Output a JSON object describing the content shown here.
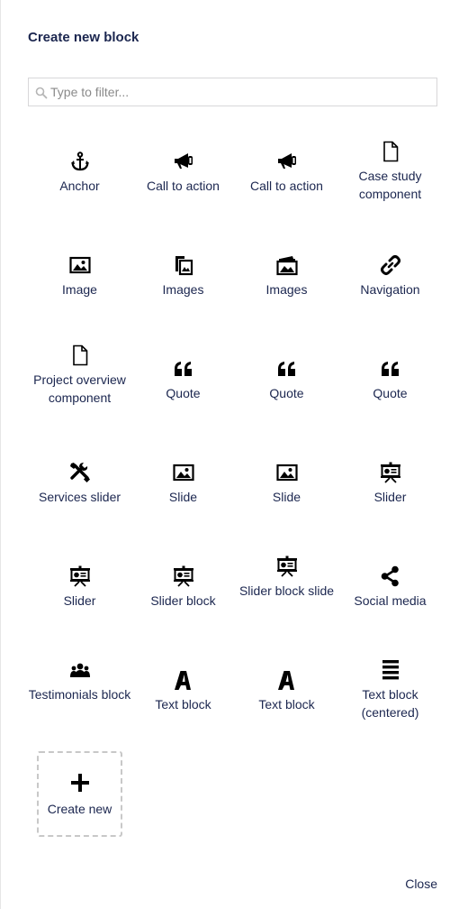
{
  "dialog": {
    "title": "Create new block",
    "search_placeholder": "Type to filter...",
    "close_label": "Close",
    "create_new_label": "Create new"
  },
  "blocks": [
    {
      "label": "Anchor",
      "icon": "anchor-icon"
    },
    {
      "label": "Call to action",
      "icon": "megaphone-icon"
    },
    {
      "label": "Call to action",
      "icon": "megaphone-icon"
    },
    {
      "label": "Case study component",
      "icon": "document-icon"
    },
    {
      "label": "Image",
      "icon": "picture-icon"
    },
    {
      "label": "Images",
      "icon": "multiple-pictures-icon"
    },
    {
      "label": "Images",
      "icon": "photo-stack-icon"
    },
    {
      "label": "Navigation",
      "icon": "link-icon"
    },
    {
      "label": "Project overview component",
      "icon": "document-icon"
    },
    {
      "label": "Quote",
      "icon": "quote-icon"
    },
    {
      "label": "Quote",
      "icon": "quote-icon"
    },
    {
      "label": "Quote",
      "icon": "quote-icon"
    },
    {
      "label": "Services slider",
      "icon": "wrench-screwdriver-icon"
    },
    {
      "label": "Slide",
      "icon": "picture-icon"
    },
    {
      "label": "Slide",
      "icon": "picture-icon"
    },
    {
      "label": "Slider",
      "icon": "presentation-icon"
    },
    {
      "label": "Slider",
      "icon": "presentation-icon"
    },
    {
      "label": "Slider block",
      "icon": "presentation-icon"
    },
    {
      "label": "Slider block slide",
      "icon": "presentation-icon"
    },
    {
      "label": "Social media",
      "icon": "share-icon"
    },
    {
      "label": "Testimonials block",
      "icon": "users-icon"
    },
    {
      "label": "Text block",
      "icon": "font-icon"
    },
    {
      "label": "Text block",
      "icon": "font-icon"
    },
    {
      "label": "Text block (centered)",
      "icon": "align-justify-icon"
    }
  ]
}
